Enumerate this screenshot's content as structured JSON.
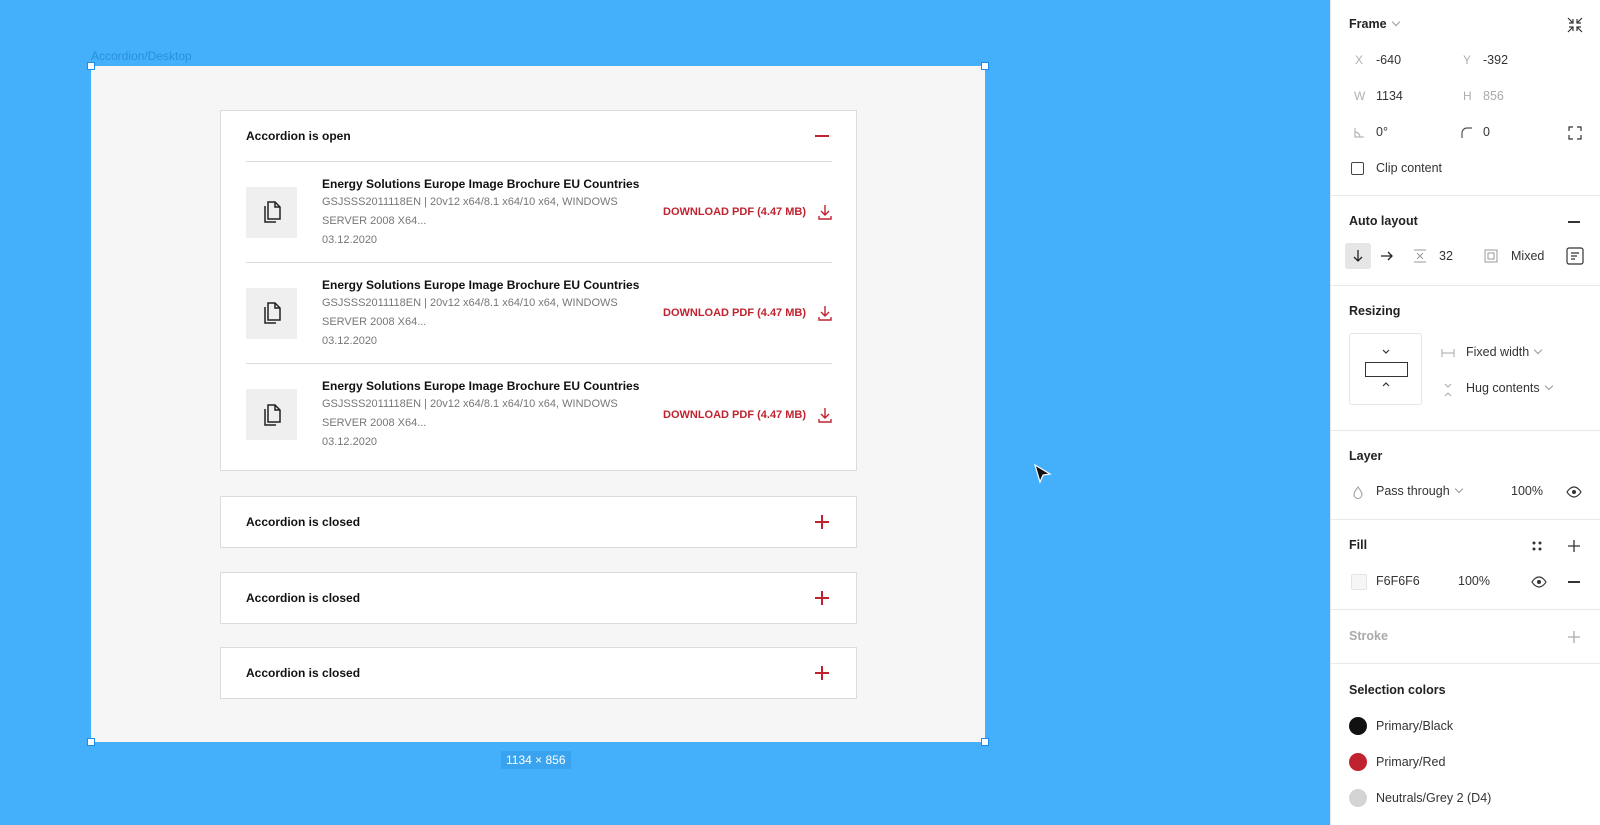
{
  "canvas": {
    "frame_label": "Accordion/Desktop",
    "size_badge": "1134 × 856",
    "accordions": {
      "open_title": "Accordion is open",
      "closed_titles": [
        "Accordion is closed",
        "Accordion is closed",
        "Accordion is closed"
      ]
    },
    "documents": [
      {
        "title": "Energy Solutions Europe Image Brochure EU Countries",
        "desc": "GSJSSS2011118EN | 20v12 x64/8.1 x64/10 x64, WINDOWS SERVER 2008 X64...",
        "date": "03.12.2020",
        "link": "DOWNLOAD PDF (4.47 MB)"
      },
      {
        "title": "Energy Solutions Europe Image Brochure EU Countries",
        "desc": "GSJSSS2011118EN | 20v12 x64/8.1 x64/10 x64, WINDOWS SERVER 2008 X64...",
        "date": "03.12.2020",
        "link": "DOWNLOAD PDF (4.47 MB)"
      },
      {
        "title": "Energy Solutions Europe Image Brochure EU Countries",
        "desc": "GSJSSS2011118EN | 20v12 x64/8.1 x64/10 x64, WINDOWS SERVER 2008 X64...",
        "date": "03.12.2020",
        "link": "DOWNLOAD PDF (4.47 MB)"
      }
    ],
    "colors": {
      "canvas_bg": "#44B0FC",
      "frame_fill": "#F6F6F6",
      "accent_red": "#C0232F"
    }
  },
  "panel": {
    "frame": {
      "title": "Frame",
      "x_label": "X",
      "x": "-640",
      "y_label": "Y",
      "y": "-392",
      "w_label": "W",
      "w": "1134",
      "h_label": "H",
      "h": "856",
      "rotation": "0°",
      "radius": "0",
      "clip_content": "Clip content"
    },
    "auto_layout": {
      "title": "Auto layout",
      "spacing": "32",
      "padding": "Mixed"
    },
    "resizing": {
      "title": "Resizing",
      "horizontal": "Fixed width",
      "vertical": "Hug contents"
    },
    "layer": {
      "title": "Layer",
      "blend": "Pass through",
      "opacity": "100%"
    },
    "fill": {
      "title": "Fill",
      "hex": "F6F6F6",
      "opacity": "100%",
      "color": "#F6F6F6"
    },
    "stroke": {
      "title": "Stroke"
    },
    "selection_colors": {
      "title": "Selection colors",
      "items": [
        {
          "name": "Primary/Black",
          "color": "#111111"
        },
        {
          "name": "Primary/Red",
          "color": "#C0232F"
        },
        {
          "name": "Neutrals/Grey 2 (D4)",
          "color": "#D4D4D4"
        }
      ]
    }
  }
}
